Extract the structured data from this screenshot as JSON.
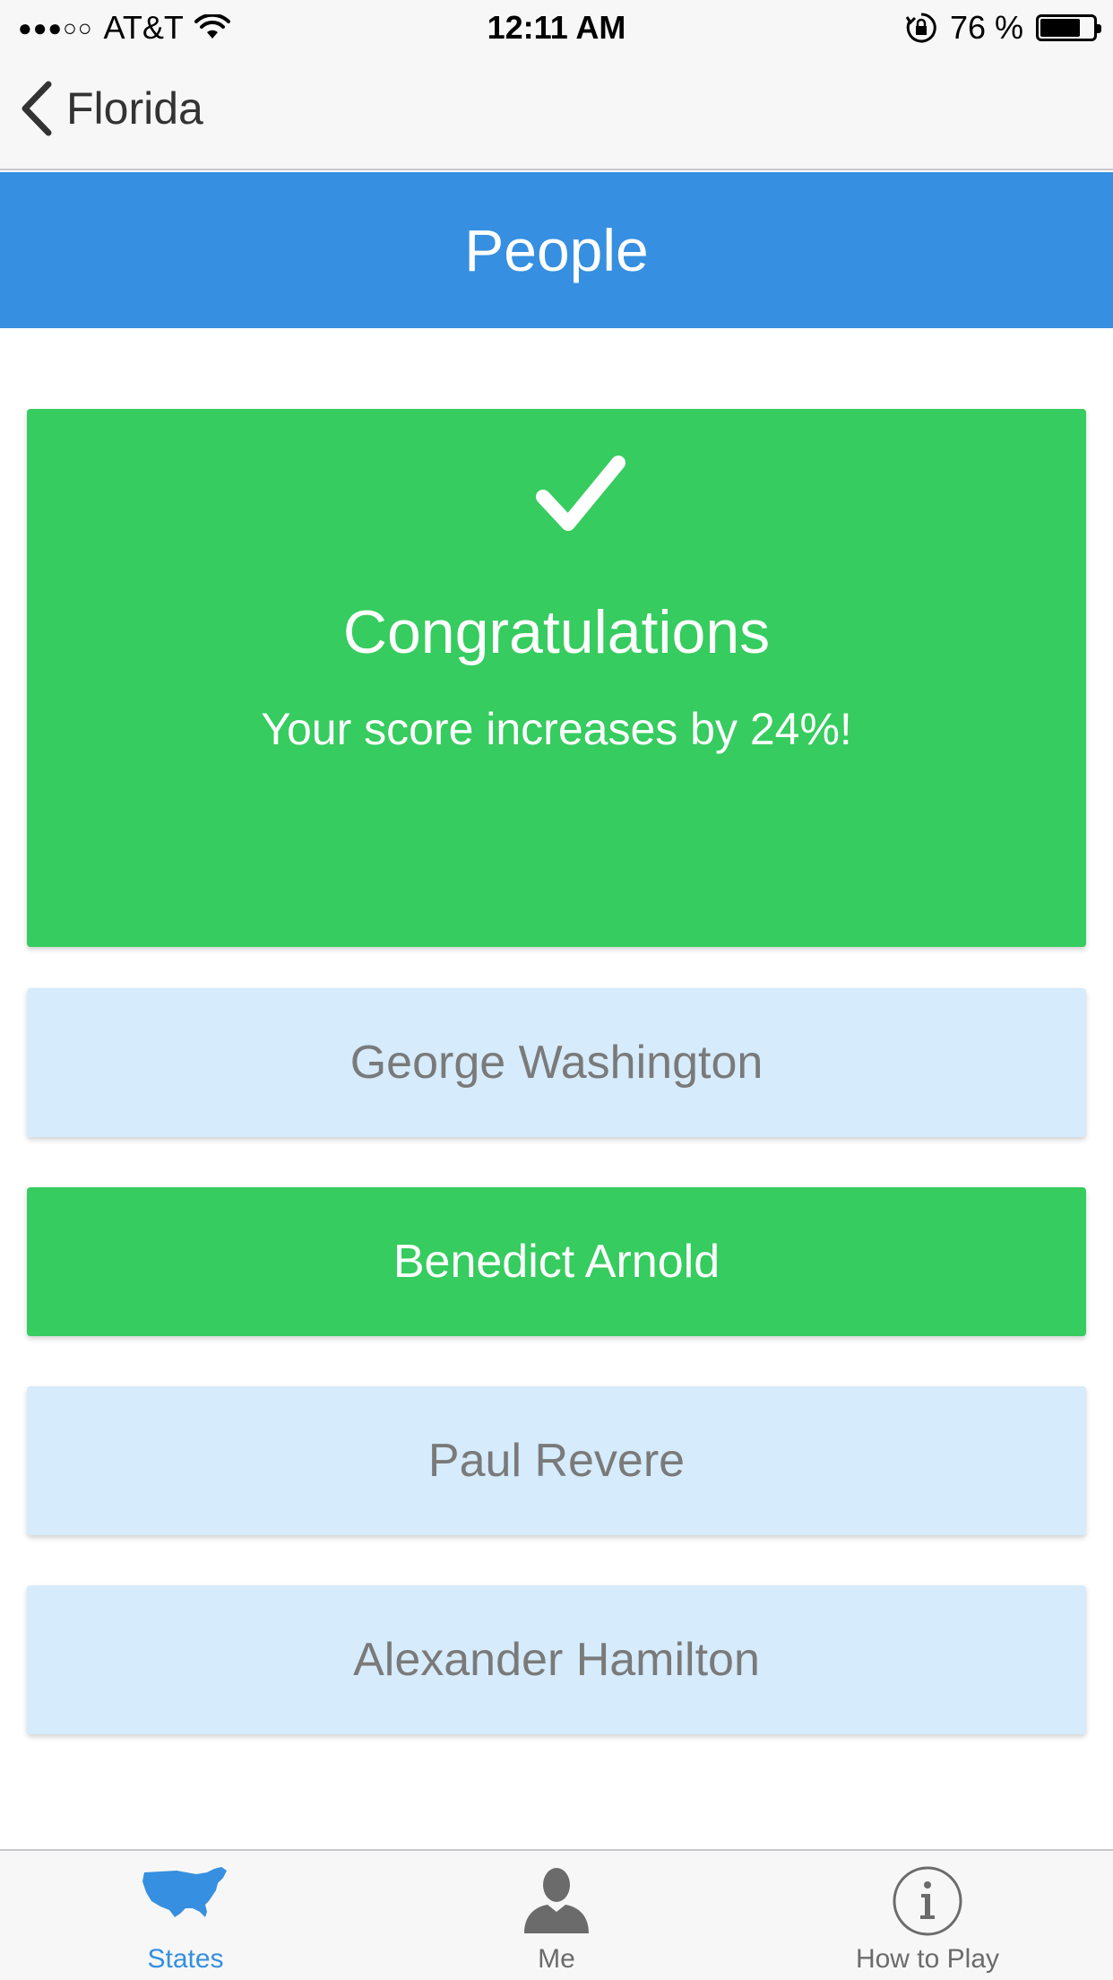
{
  "status_bar": {
    "signal": "●●●○○",
    "carrier": "AT&T",
    "time": "12:11 AM",
    "battery_text": "76 %",
    "battery_level": 0.76
  },
  "nav": {
    "back_label": "Florida"
  },
  "header": {
    "title": "People"
  },
  "result": {
    "title": "Congratulations",
    "subtitle": "Your score increases by 24%!"
  },
  "options": [
    {
      "label": "George Washington",
      "state": "neutral"
    },
    {
      "label": "Benedict Arnold",
      "state": "correct"
    },
    {
      "label": "Paul Revere",
      "state": "neutral"
    },
    {
      "label": "Alexander Hamilton",
      "state": "neutral"
    }
  ],
  "tabs": [
    {
      "label": "States",
      "icon": "usa-map-icon",
      "active": true
    },
    {
      "label": "Me",
      "icon": "person-icon",
      "active": false
    },
    {
      "label": "How to Play",
      "icon": "info-icon",
      "active": false
    }
  ],
  "colors": {
    "accent_blue": "#368fe0",
    "success_green": "#36cc5f",
    "option_neutral": "#d6ebfb",
    "option_text": "#7a7a7a"
  }
}
